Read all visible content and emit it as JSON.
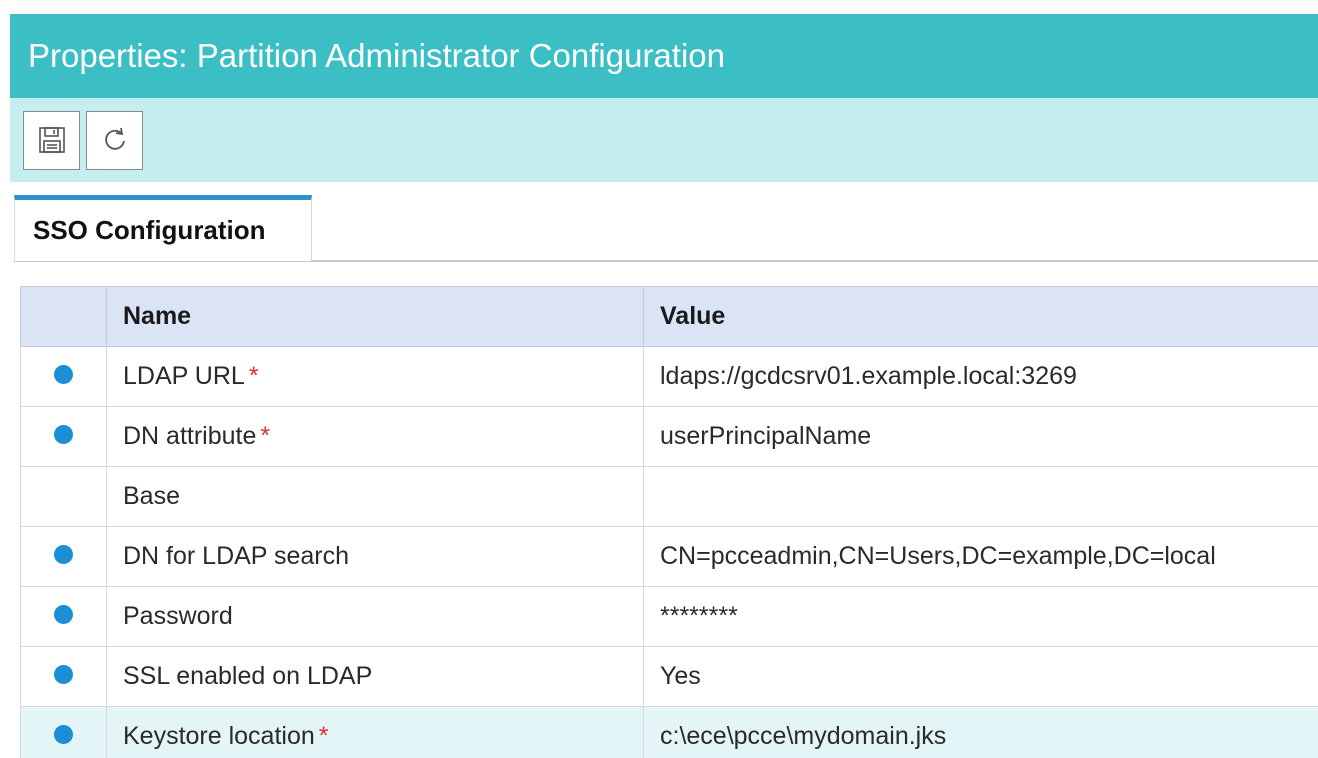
{
  "window": {
    "title": "Properties: Partition Administrator Configuration"
  },
  "toolbar": {
    "buttons": [
      {
        "icon": "save-icon"
      },
      {
        "icon": "refresh-icon"
      }
    ]
  },
  "tabs": [
    {
      "label": "SSO Configuration",
      "active": true
    }
  ],
  "grid": {
    "headers": {
      "name": "Name",
      "value": "Value"
    },
    "rows": [
      {
        "name": "LDAP URL",
        "required": "*",
        "value": "ldaps://gcdcsrv01.example.local:3269",
        "has_dot": true
      },
      {
        "name": "DN attribute",
        "required": "*",
        "value": "userPrincipalName",
        "has_dot": true
      },
      {
        "name": "Base",
        "required": "",
        "value": "",
        "has_dot": false
      },
      {
        "name": "DN for LDAP search",
        "required": "",
        "value": "CN=pcceadmin,CN=Users,DC=example,DC=local",
        "has_dot": true
      },
      {
        "name": "Password",
        "required": "",
        "value": "********",
        "has_dot": true
      },
      {
        "name": "SSL enabled on LDAP",
        "required": "",
        "value": "Yes",
        "has_dot": true
      },
      {
        "name": "Keystore location",
        "required": "*",
        "value": "c:\\ece\\pcce\\mydomain.jks",
        "has_dot": true,
        "selected": true
      }
    ]
  },
  "colors": {
    "title_bar": "#3bbfc4",
    "toolbar": "#c5eef0",
    "tab_accent": "#2a93c9",
    "header_bg": "#dbe4f4",
    "status_dot": "#1a8fd8",
    "required_marker": "#e0312f",
    "selected_row": "#e3f5f7"
  }
}
